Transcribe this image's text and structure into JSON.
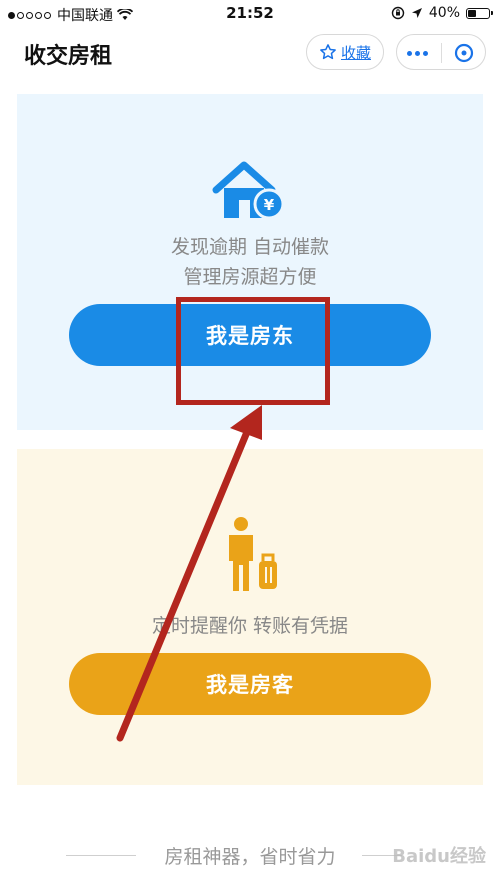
{
  "status_bar": {
    "carrier": "中国联通",
    "time": "21:52",
    "battery": "40%",
    "battery_level": 0.4
  },
  "nav": {
    "title": "收交房租",
    "favorite_label": "收藏"
  },
  "landlord_card": {
    "line1": "发现逾期  自动催款",
    "line2": "管理房源超方便",
    "button_label": "我是房东",
    "icon": "house-yen-icon"
  },
  "tenant_card": {
    "line1": "定时提醒你 转账有凭据",
    "button_label": "我是房客",
    "icon": "traveler-luggage-icon"
  },
  "footer": {
    "slogan": "房租神器，省时省力"
  },
  "watermark": "Baidu经验",
  "colors": {
    "primary_blue": "#1a8be6",
    "accent_orange": "#eaa318",
    "landlord_bg": "#ebf6fe",
    "tenant_bg": "#fdf7e6",
    "annotation_red": "#b3261e"
  }
}
